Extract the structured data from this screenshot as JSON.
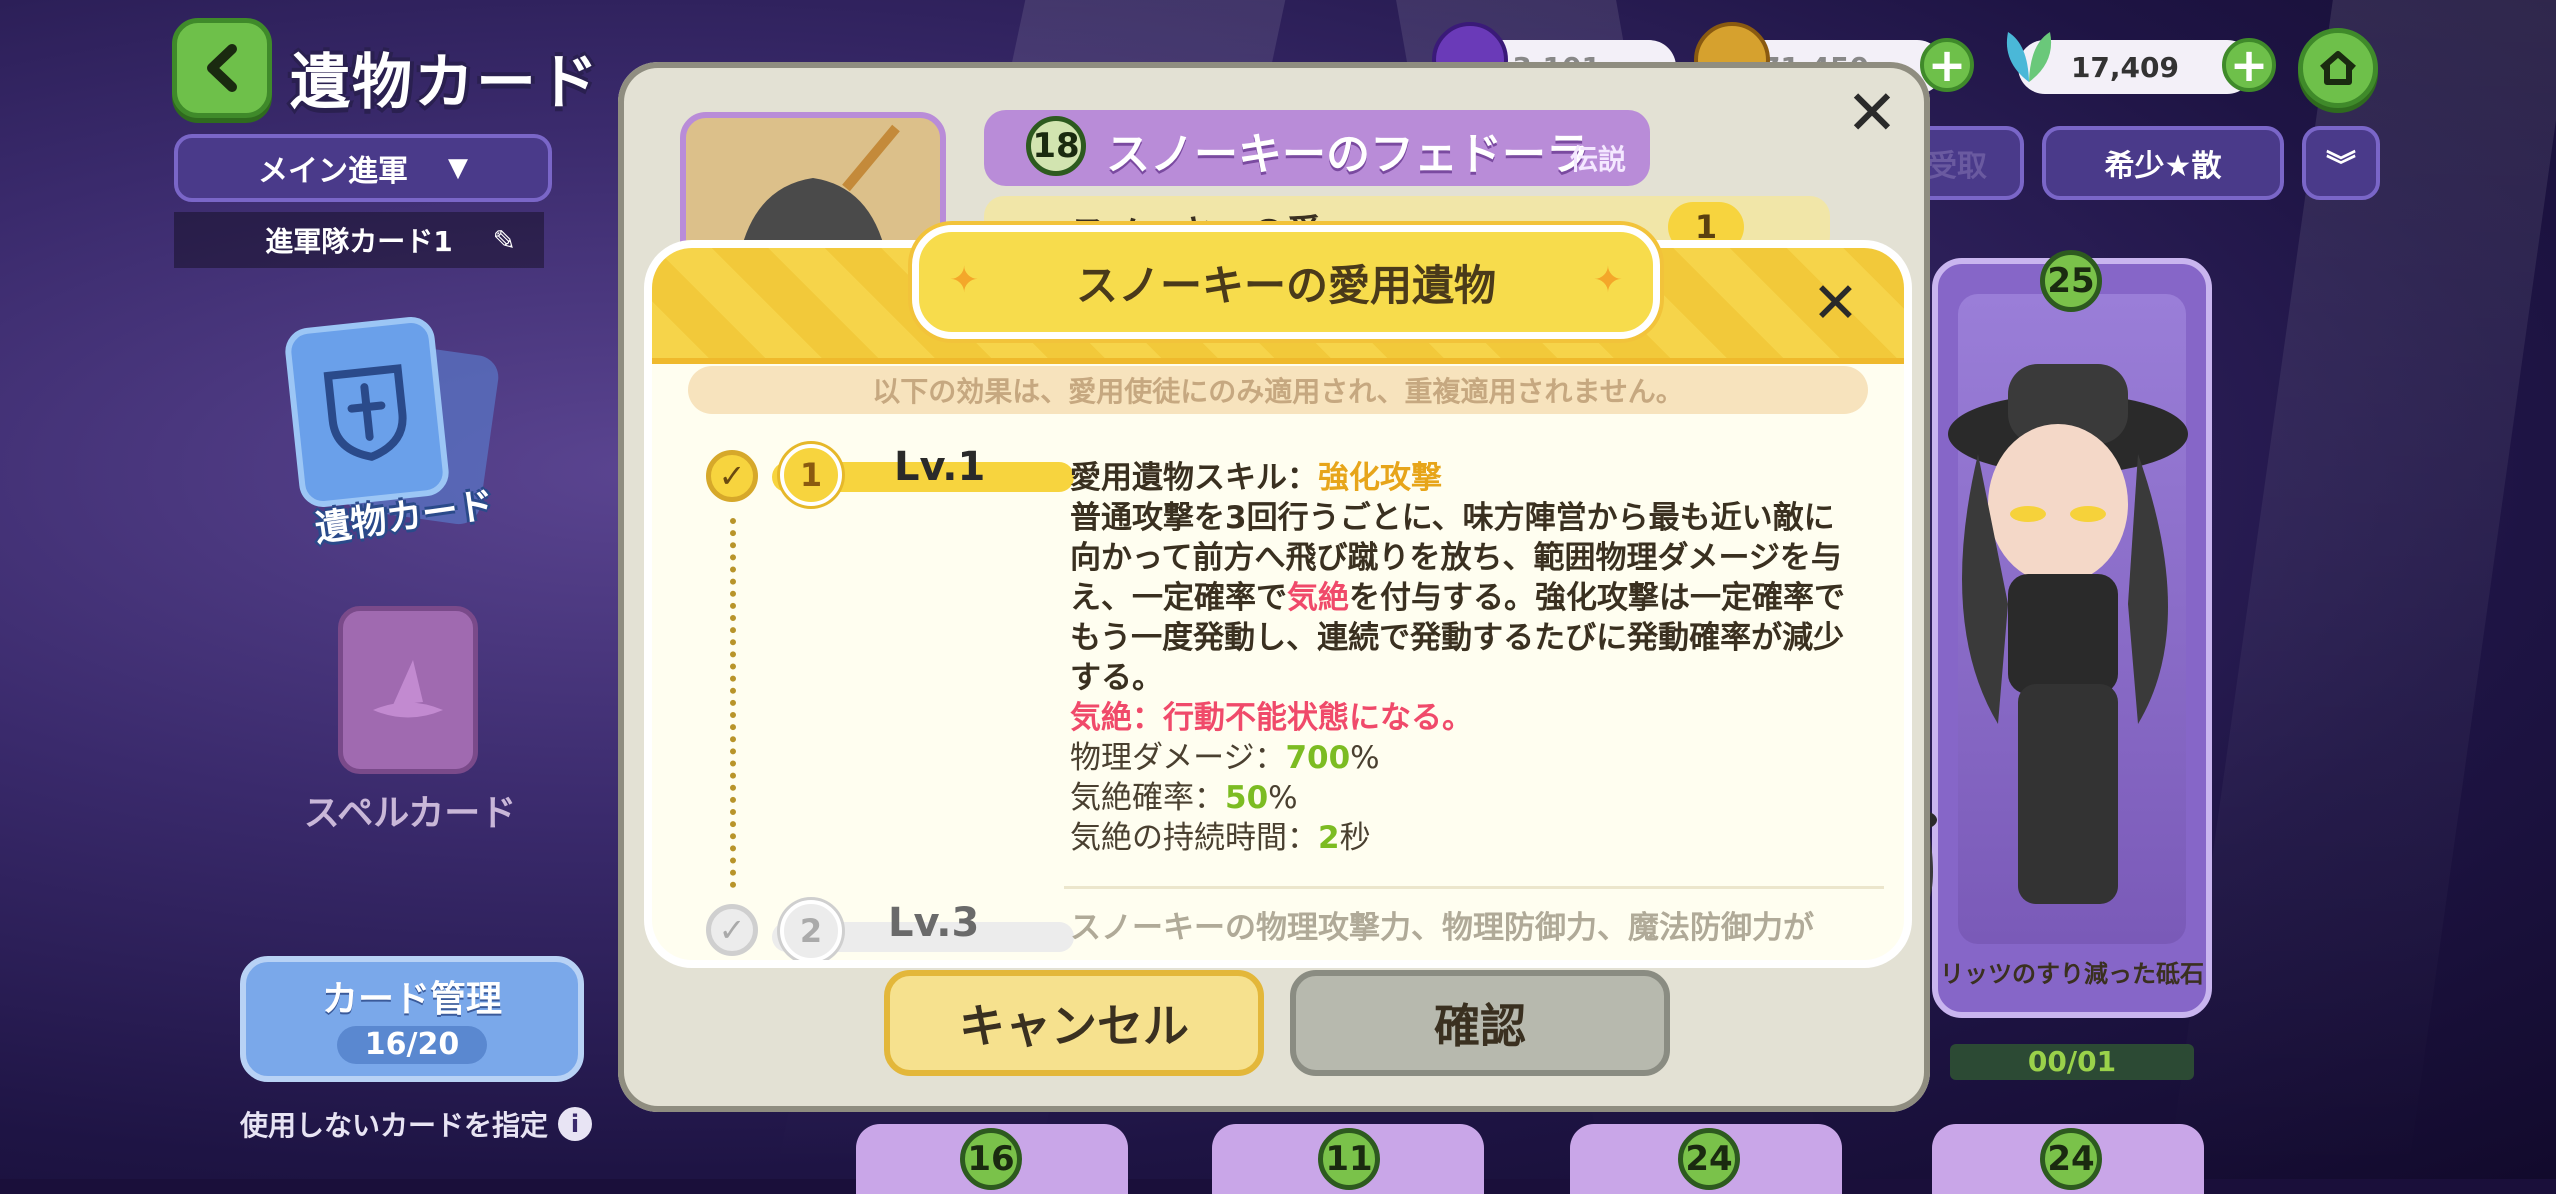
{
  "screen": {
    "title": "遺物カード",
    "back_icon": "chevron-left-icon",
    "home_icon": "home-icon"
  },
  "currencies": [
    {
      "icon": "purple-gem-icon",
      "value": "3,101"
    },
    {
      "icon": "gold-coin-icon",
      "value": "2,971,450"
    },
    {
      "icon": "leaf-icon",
      "value": "17,409"
    }
  ],
  "filters": {
    "mode_dropdown": "メイン進軍",
    "formation_label": "進軍隊カード1",
    "right_filter_partial": "受取",
    "sort_dropdown": "希少★散"
  },
  "sidebar": {
    "relic_card_label": "遺物カード",
    "spell_card_label": "スペルカード",
    "card_manage_label": "カード管理",
    "card_manage_count": "16/20",
    "unused_label": "使用しないカードを指定"
  },
  "relic_dialog": {
    "level": "18",
    "name": "スノーキーのフェドーラ",
    "rarity": "伝説",
    "owner_partial": "スノーキーの愛",
    "owner_level": "1",
    "cancel_label": "キャンセル",
    "confirm_label": "確認"
  },
  "modal": {
    "title": "スノーキーの愛用遺物",
    "notice": "以下の効果は、愛用使徒にのみ適用され、重複適用されません。",
    "levels": [
      {
        "badge": "1",
        "level_label": "Lv.1",
        "skill_prefix": "愛用遺物スキル：",
        "skill_name": "強化攻撃",
        "desc_1": "普通攻撃を3回行うごとに、味方陣営から最も近い敵に向かって前方へ飛び蹴りを放ち、範囲物理ダメージを与え、一定確率で",
        "desc_red": "気絶",
        "desc_2": "を付与する。強化攻撃は一定確率でもう一度発動し、連続で発動するたびに発動確率が減少する。",
        "stun_note": "気絶：行動不能状態になる。",
        "stat1_label": "物理ダメージ：",
        "stat1_value": "700",
        "stat1_unit": "%",
        "stat2_label": "気絶確率：",
        "stat2_value": "50",
        "stat2_unit": "%",
        "stat3_label": "気絶の持続時間：",
        "stat3_value": "2",
        "stat3_unit": "秒"
      },
      {
        "badge": "2",
        "level_label": "Lv.3",
        "desc_partial": "スノーキーの物理攻撃力、物理防御力、魔法防御力が"
      }
    ]
  },
  "right_card": {
    "level": "25",
    "name": "リッツのすり減った砥石",
    "progress_text": "00/01"
  },
  "bottom_badges": [
    "16",
    "11",
    "24",
    "24"
  ],
  "colors": {
    "accent_yellow": "#f6d44a",
    "accent_green": "#6ec04a",
    "highlight_red": "#f04a6a",
    "highlight_green": "#7cbc22",
    "highlight_gold": "#e7a51a",
    "panel_purple": "#4a3a8a"
  }
}
